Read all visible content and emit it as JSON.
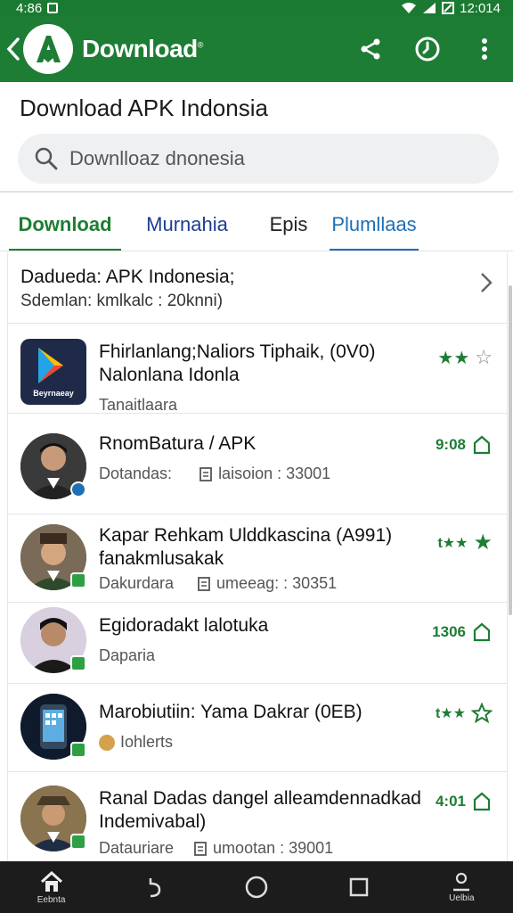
{
  "status_bar": {
    "left_text": "4:86",
    "time": "12:014"
  },
  "app_bar": {
    "title": "Download",
    "mark": "®"
  },
  "page_title": "Download APK Indonsia",
  "search": {
    "placeholder": "Downlloaz dnonesia"
  },
  "tabs": [
    {
      "label": "Download",
      "active": true
    },
    {
      "label": "Murnahia",
      "active": false
    },
    {
      "label": "Epis",
      "active": false
    },
    {
      "label": "Plumllaas",
      "active": false
    }
  ],
  "featured": {
    "title": "Dadueda: APK Indonesia;",
    "subtitle": "Sdemlan:  kmlkalc : 20knni)"
  },
  "items": [
    {
      "title_1": "Fhirlanlang;Naliors Tiphaik, (0V0)",
      "title_2": "Nalonlana Idonla",
      "sub": "Tanaitlaara",
      "thumb_label": "Beyrnaeay",
      "rating": "2/3"
    },
    {
      "title_1": "RnomBatura / APK",
      "sub": "Dotandas:",
      "meta": "laisoion : 33001",
      "count": "9:08"
    },
    {
      "title_1": "Kapar Rehkam Ulddkascina (A991)",
      "title_2": "fanakmlusakak",
      "sub": "Dakurdara",
      "meta": "umeeag: : 30351",
      "rating": "2 +1"
    },
    {
      "title_1": "Egidoradakt lalotuka",
      "sub": "Daparia",
      "count": "1306"
    },
    {
      "title_1": "Marobiutiin: Yama Dakrar (0EB)",
      "sub": "Iohlerts",
      "rating": "2/3"
    },
    {
      "title_1": "Ranal Dadas dangel alleamdennadkad",
      "title_2": "Indemivabal)",
      "sub": "Datauriare",
      "meta": "umootan : 39001",
      "count": "4:01"
    }
  ],
  "nav": {
    "home_label": "Eebnta",
    "profile_label": "Uelbia"
  },
  "colors": {
    "primary": "#1e7d34",
    "tab_blue": "#1d3d8f",
    "tab_light_blue": "#1f6fb5"
  }
}
